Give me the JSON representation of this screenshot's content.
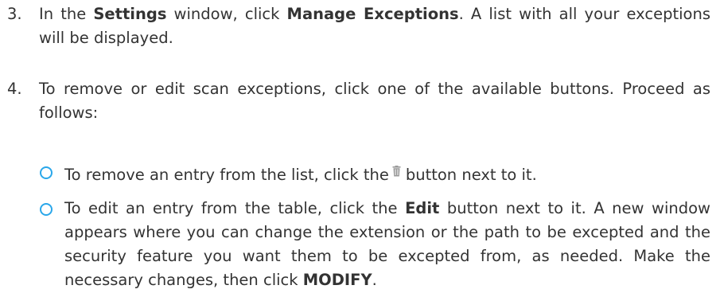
{
  "steps": [
    {
      "number": "3.",
      "parts": {
        "t1": "In the ",
        "b1": "Settings",
        "t2": " window, click ",
        "b2": "Manage Exceptions",
        "t3": ". A list with all your exceptions will be displayed."
      }
    },
    {
      "number": "4.",
      "parts": {
        "t1": "To remove or edit scan exceptions, click one of the available buttons. Proceed as follows:"
      }
    }
  ],
  "bullets": [
    {
      "parts": {
        "t1": "To remove an entry from the list, click the",
        "icon": "trash-icon",
        "t2": "button next to it."
      }
    },
    {
      "parts": {
        "t1": "To edit an entry from the table, click the ",
        "b1": "Edit",
        "t2": " button next to it. A new window appears where you can change the extension or the path to be excepted and the security feature you want them to be excepted from, as needed. Make the necessary changes, then click ",
        "b2": "MODIFY",
        "t3": "."
      }
    }
  ],
  "colors": {
    "text": "#333333",
    "bullet_circle": "#2aa7ea",
    "icon": "#9a9a9a"
  }
}
